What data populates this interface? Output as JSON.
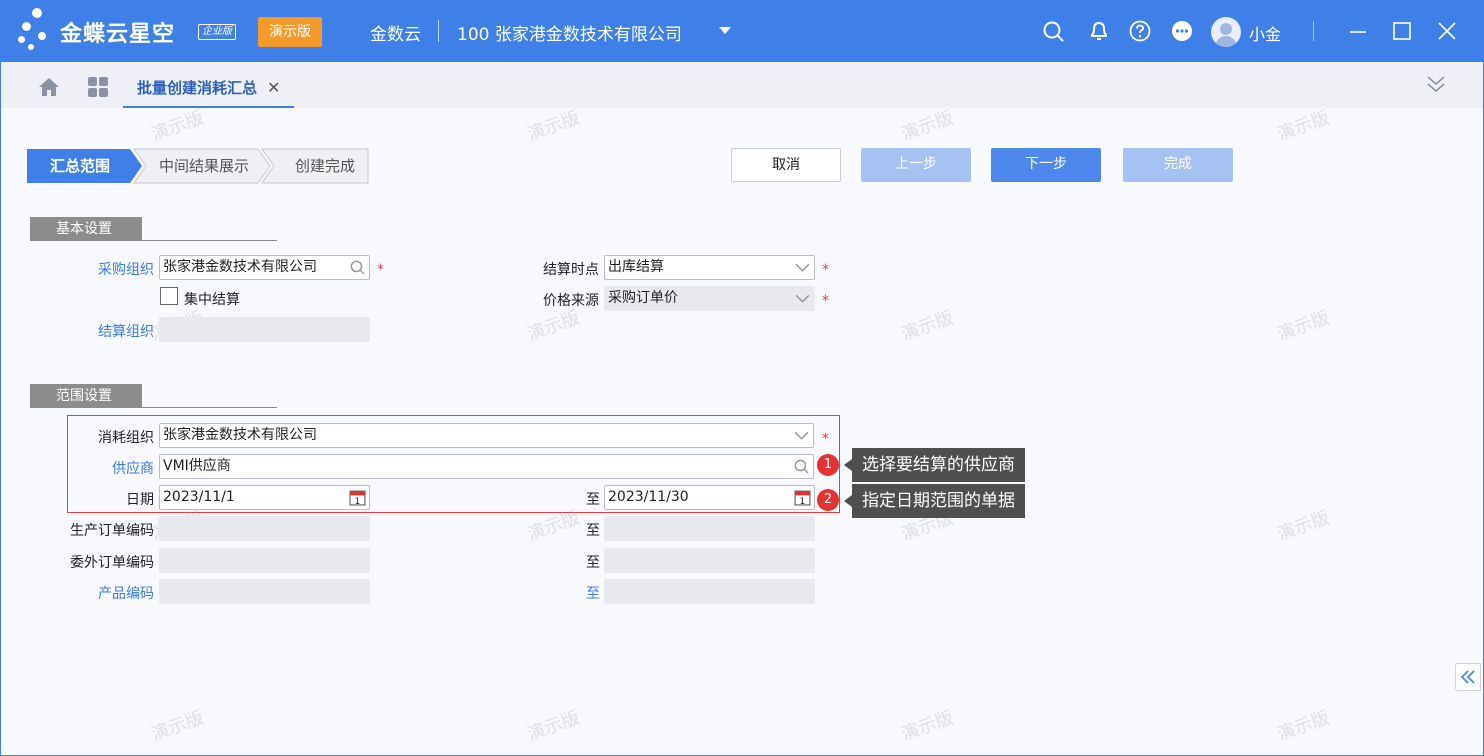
{
  "titlebar": {
    "brand": "金蝶云星空",
    "edition_badge": "企业版",
    "demo_badge": "演示版",
    "product": "金数云",
    "company": "100 张家港金数技术有限公司",
    "user_name": "小金"
  },
  "tabs": {
    "active_label": "批量创建消耗汇总",
    "close_glyph": "✕"
  },
  "watermark": "演示版",
  "steps": [
    "汇总范围",
    "中间结果展示",
    "创建完成"
  ],
  "buttons": {
    "cancel": "取消",
    "prev": "上一步",
    "next": "下一步",
    "finish": "完成"
  },
  "basic": {
    "title": "基本设置",
    "purchase_org_label": "采购组织",
    "purchase_org_value": "张家港金数技术有限公司",
    "centralized_label": "集中结算",
    "settle_org_label": "结算组织",
    "settle_time_label": "结算时点",
    "settle_time_value": "出库结算",
    "price_source_label": "价格来源",
    "price_source_value": "采购订单价"
  },
  "range": {
    "title": "范围设置",
    "consume_org_label": "消耗组织",
    "consume_org_value": "张家港金数技术有限公司",
    "supplier_label": "供应商",
    "supplier_value": "VMI供应商",
    "date_label": "日期",
    "date_from": "2023/11/1",
    "to_label": "至",
    "date_to": "2023/11/30",
    "prod_order_label": "生产订单编码",
    "outsource_order_label": "委外订单编码",
    "product_code_label": "产品编码"
  },
  "callouts": [
    {
      "num": "1",
      "text": "选择要结算的供应商"
    },
    {
      "num": "2",
      "text": "指定日期范围的单据"
    }
  ],
  "colors": {
    "accent": "#3f7fe8",
    "demo_badge": "#f39a2b",
    "required": "#e23c3c",
    "highlight_box": "#e23c3c"
  }
}
